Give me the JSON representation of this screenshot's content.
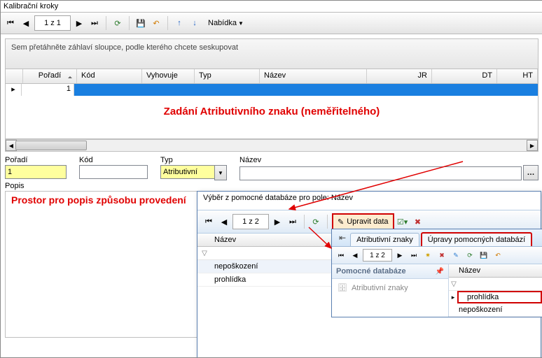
{
  "title": "Kalibrační kroky",
  "toolbar": {
    "page": "1 z 1",
    "menu": "Nabídka"
  },
  "groupbar": "Sem přetáhněte záhlaví sloupce, podle kterého chcete seskupovat",
  "grid": {
    "cols": [
      "Pořadí",
      "Kód",
      "Vyhovuje",
      "Typ",
      "Název",
      "JR",
      "DT",
      "HT"
    ],
    "row": {
      "poradi": "1"
    }
  },
  "annotation1": "Zadání Atributivního znaku (neměřitelného)",
  "form": {
    "poradi": {
      "label": "Pořadí",
      "value": "1"
    },
    "kod": {
      "label": "Kód",
      "value": ""
    },
    "typ": {
      "label": "Typ",
      "value": "Atributivní"
    },
    "nazev": {
      "label": "Název",
      "value": ""
    }
  },
  "popis": {
    "label": "Popis",
    "text": "Prostor pro popis způsobu provedení"
  },
  "popup1": {
    "title": "Výběr z pomocné databáze pro pole: Název",
    "page": "1 z 2",
    "edit": "Upravit data",
    "col": "Název",
    "rows": [
      "nepoškození",
      "prohlídka"
    ]
  },
  "popup2": {
    "tab_back": "Atributivní znaky",
    "tab_hl": "Úpravy pomocných databází",
    "page": "1 z 2",
    "panel_title": "Pomocné databáze",
    "panel_item": "Atributivní znaky",
    "col": "Název",
    "rows": [
      "prohlídka",
      "nepoškození"
    ]
  }
}
